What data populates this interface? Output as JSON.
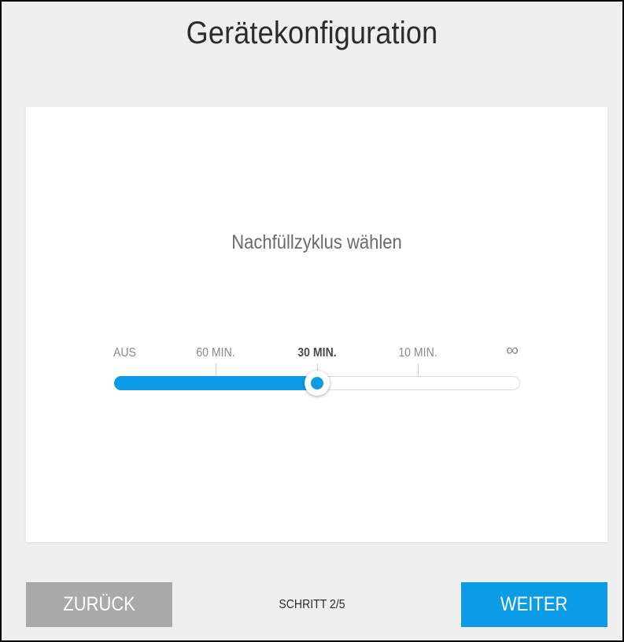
{
  "page": {
    "title": "Gerätekonfiguration"
  },
  "card": {
    "heading": "Nachfüllzyklus wählen"
  },
  "slider": {
    "options": [
      {
        "label": "AUS"
      },
      {
        "label": "60 MIN."
      },
      {
        "label": "30 MIN."
      },
      {
        "label": "10 MIN."
      },
      {
        "label": "∞"
      }
    ],
    "selected_index": 2,
    "selected_label": "30 MIN.",
    "fill_fraction": 0.5
  },
  "footer": {
    "back_label": "ZURÜCK",
    "step_text": "SCHRITT 2/5",
    "next_label": "WEITER"
  },
  "colors": {
    "accent": "#0c9ce6",
    "back_button": "#a9a9a9",
    "background": "#efefef",
    "card": "#ffffff"
  },
  "icons": {
    "infinity": "infinity-icon"
  }
}
